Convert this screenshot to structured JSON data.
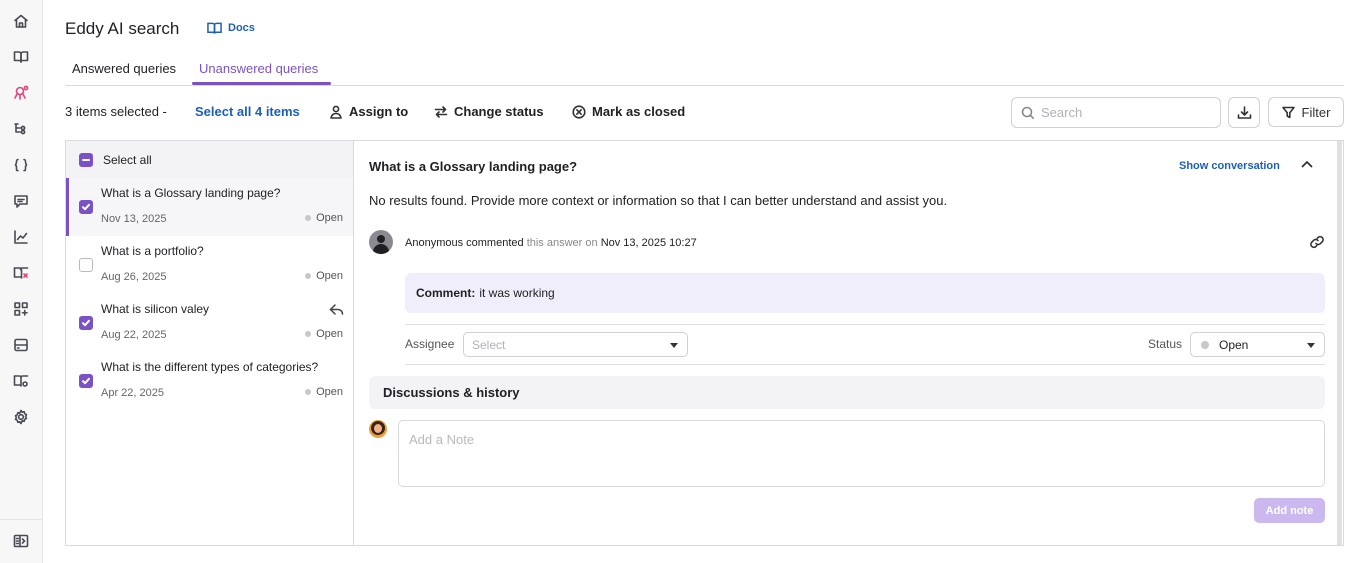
{
  "header": {
    "title": "Eddy AI search",
    "docs_label": "Docs"
  },
  "tabs": [
    {
      "label": "Answered queries",
      "active": false
    },
    {
      "label": "Unanswered queries",
      "active": true
    }
  ],
  "toolbar": {
    "selected_count": "3 items selected -",
    "select_all_items": "Select all 4 items",
    "assign_to": "Assign to",
    "change_status": "Change status",
    "mark_closed": "Mark as closed",
    "search_placeholder": "Search",
    "filter_label": "Filter"
  },
  "list": {
    "select_all_label": "Select all",
    "items": [
      {
        "question": "What is a Glossary landing page?",
        "date": "Nov 13, 2025",
        "status": "Open",
        "checked": true
      },
      {
        "question": "What is a portfolio?",
        "date": "Aug 26, 2025",
        "status": "Open",
        "checked": false
      },
      {
        "question": "What is silicon valey",
        "date": "Aug 22, 2025",
        "status": "Open",
        "checked": true
      },
      {
        "question": "What is the different types of categories?",
        "date": "Apr 22, 2025",
        "status": "Open",
        "checked": true
      }
    ]
  },
  "detail": {
    "question": "What is a Glossary landing page?",
    "show_conversation": "Show conversation",
    "answer": "No results found. Provide more context or information so that I can better understand and assist you.",
    "comment_author": "Anonymous commented",
    "comment_mid": "this answer on",
    "comment_datetime": "Nov 13, 2025 10:27",
    "comment_label": "Comment:",
    "comment_text": "it was working",
    "assignee_label": "Assignee",
    "assignee_placeholder": "Select",
    "status_label": "Status",
    "status_value": "Open",
    "discussions_label": "Discussions & history",
    "note_placeholder": "Add a Note",
    "add_note_label": "Add note"
  },
  "colors": {
    "accent": "#7a52c6",
    "link": "#1d5fb8"
  }
}
